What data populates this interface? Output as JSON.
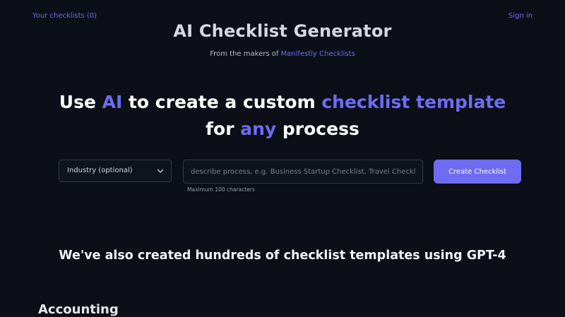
{
  "nav": {
    "checklists_link": "Your checklists (0)",
    "signin_link": "Sign in"
  },
  "header": {
    "title": "AI Checklist Generator",
    "subtitle_prefix": "From the makers of",
    "subtitle_link": "Manifestly Checklists"
  },
  "hero": {
    "part1": "Use ",
    "accent1": "AI",
    "part2": " to create a custom ",
    "accent2": "checklist template",
    "part3": " for ",
    "accent3": "any",
    "part4": " process"
  },
  "form": {
    "industry_select": "Industry (optional)",
    "process_placeholder": "describe process, e.g. Business Startup Checklist, Travel Checklist, e",
    "process_value": "",
    "submit_label": "Create Checklist",
    "hint": "Maximum 100 characters"
  },
  "templates": {
    "heading": "We've also created hundreds of checklist templates using GPT-4",
    "first_category": "Accounting"
  },
  "colors": {
    "background": "#0c0f17",
    "accent": "#6d6cf3"
  }
}
